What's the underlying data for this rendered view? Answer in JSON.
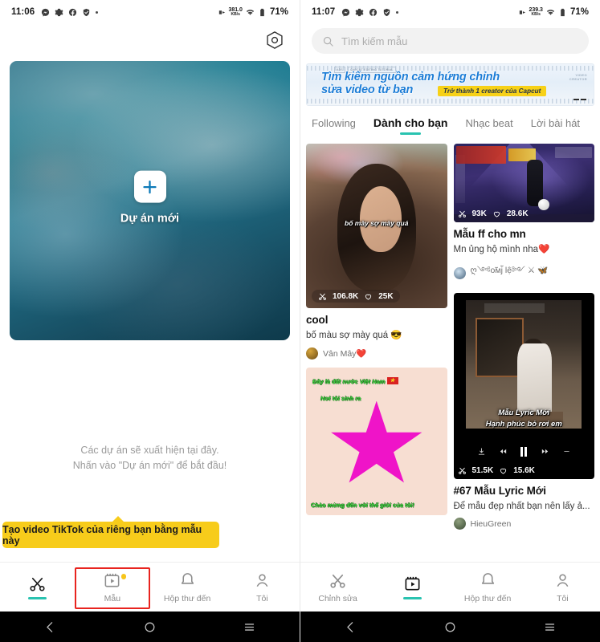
{
  "left": {
    "status": {
      "time": "11:06",
      "net_rate": "381.0",
      "net_unit": "KB/s",
      "battery": "71%"
    },
    "settings_icon": "hex-settings-icon",
    "project": {
      "plus_icon": "plus-icon",
      "label": "Dự án mới"
    },
    "empty_hint_line1": "Các dự án sẽ xuất hiện tại đây.",
    "empty_hint_line2": "Nhấn vào \"Dự án mới\" để bắt đầu!",
    "tooltip": "Tạo video TikTok của riêng bạn bằng mẫu này",
    "nav": [
      {
        "icon": "scissors-icon",
        "label": "",
        "active": true
      },
      {
        "icon": "template-icon",
        "label": "Mẫu",
        "active": false,
        "badge": true,
        "highlighted": true
      },
      {
        "icon": "bell-icon",
        "label": "Hộp thư đến",
        "active": false
      },
      {
        "icon": "person-icon",
        "label": "Tôi",
        "active": false
      }
    ]
  },
  "right": {
    "status": {
      "time": "11:07",
      "net_rate": "239.3",
      "net_unit": "KB/s",
      "battery": "71%"
    },
    "search": {
      "icon": "search-icon",
      "placeholder": "Tìm kiếm mẫu"
    },
    "banner": {
      "tag1": "ADS",
      "tag2": "CAPCUT EDITING TUTORIAL",
      "line1": "Tìm kiếm nguồn cảm hứng chỉnh",
      "line2": "sửa video từ bạn",
      "pill": "Trở thành 1 creator của Capcut",
      "corner1": "VIDEO",
      "corner2": "CREATOR"
    },
    "tabs": [
      {
        "label": "Following",
        "active": false
      },
      {
        "label": "Dành cho bạn",
        "active": true
      },
      {
        "label": "Nhạc beat",
        "active": false
      },
      {
        "label": "Lời bài hát",
        "active": false
      }
    ],
    "cards": [
      {
        "id": "cool",
        "overlay_caption": "bố mày sợ mày quá",
        "uses": "106.8K",
        "likes": "25K",
        "title": "cool",
        "desc": "bố màu sợ mày quá 😎",
        "author": "Vân Mây❤️"
      },
      {
        "id": "ff",
        "uses": "93K",
        "likes": "28.6K",
        "title": "Mẫu ff cho mn",
        "desc": "Mn ủng hộ mình nha❤️",
        "author": "ღ༺ᴏ̃ᴍj̃ ӏệ༻ ⚔ 🦋"
      },
      {
        "id": "lyric",
        "overlay_line1": "Mẫu Lyric Mới",
        "overlay_line2": "Hạnh phúc bỏ rơi em",
        "uses": "51.5K",
        "likes": "15.6K",
        "title": "#67 Mẫu Lyric Mới",
        "desc": "Để mẫu đẹp nhất bạn nên lấy ả...",
        "author": "HieuGreen"
      },
      {
        "id": "star",
        "overlay_line1": "Đây là đất nước Việt Nam",
        "overlay_line2": "Nơi tôi sinh ra",
        "overlay_line3": "Chào mừng đến với thế giới của tôi!"
      }
    ],
    "nav": [
      {
        "icon": "scissors-icon",
        "label": "Chỉnh sửa",
        "active": false
      },
      {
        "icon": "template-icon",
        "label": "",
        "active": true
      },
      {
        "icon": "bell-icon",
        "label": "Hộp thư đến",
        "active": false
      },
      {
        "icon": "person-icon",
        "label": "Tôi",
        "active": false
      }
    ]
  },
  "android_nav": {
    "back": "back-icon",
    "home": "home-icon",
    "recents": "recents-icon"
  }
}
